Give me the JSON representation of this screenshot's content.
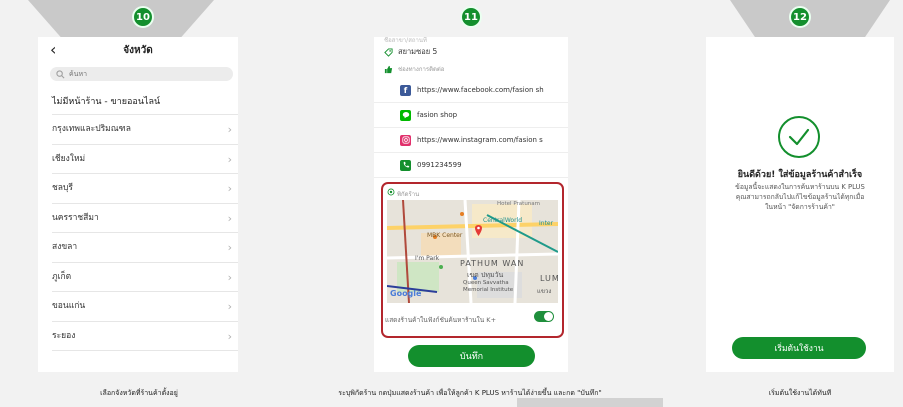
{
  "steps": [
    "10",
    "11",
    "12"
  ],
  "phone1": {
    "title": "จังหวัด",
    "search_placeholder": "ค้นหา",
    "online_option": "ไม่มีหน้าร้าน - ขายออนไลน์",
    "provinces": [
      "กรุงเทพและปริมณฑล",
      "เชียงใหม่",
      "ชลบุรี",
      "นครราชสีมา",
      "สงขลา",
      "ภูเก็ต",
      "ขอนแก่น",
      "ระยอง"
    ]
  },
  "phone2": {
    "branch_label": "ชื่อสาขา/สถานที่",
    "branch_value": "สยามซอย 5",
    "contact_label": "ช่องทางการติดต่อ",
    "contacts": [
      {
        "icon": "facebook-icon",
        "color": "#3b5998",
        "value": "https://www.facebook.com/fasion sh"
      },
      {
        "icon": "line-icon",
        "color": "#00b900",
        "value": "fasion shop"
      },
      {
        "icon": "instagram-icon",
        "color": "#e1306c",
        "value": "https://www.instagram.com/fasion s"
      },
      {
        "icon": "phone-icon",
        "color": "#138f2d",
        "value": "0991234599"
      }
    ],
    "location_label": "พิกัดร้าน",
    "map_labels": {
      "district": "PATHUM WAN",
      "district_thai": "เขต ปทุมวัน",
      "mall": "CentralWorld",
      "center": "MBK Center",
      "park": "I'm Park",
      "institute": "Queen Savvatha Memorial Institute",
      "pratunam": "Hotel Pratunam",
      "inter": "Inter",
      "lum": "LUM",
      "road": "แขวง",
      "brand": "Google"
    },
    "show_toggle_label": "แสดงร้านค้าในฟังก์ชันค้นหาร้านใน K+",
    "save_label": "บันทึก"
  },
  "phone3": {
    "success_title": "ยินดีด้วย! ใส่ข้อมูลร้านค้าสำเร็จ",
    "success_body_1": "ข้อมูลนี้จะแสดงในการค้นหาร้านบน K PLUS",
    "success_body_2": "คุณสามารถกลับไปแก้ไขข้อมูลร้านได้ทุกเมื่อ",
    "success_body_3": "ในหน้า \"จัดการร้านค้า\"",
    "start_label": "เริ่มต้นใช้งาน"
  },
  "captions": {
    "c1": "เลือกจังหวัดที่ร้านค้าตั้งอยู่",
    "c2": "ระบุพิกัดร้าน กดปุ่มแสดงร้านค้า เพื่อให้ลูกค้า K PLUS หาร้านได้ง่ายขึ้น และกด \"บันทึก\"",
    "c3": "เริ่มต้นใช้งานได้ทันที"
  },
  "colors": {
    "brand_green": "#138f2d",
    "highlight_red": "#b3262d"
  }
}
